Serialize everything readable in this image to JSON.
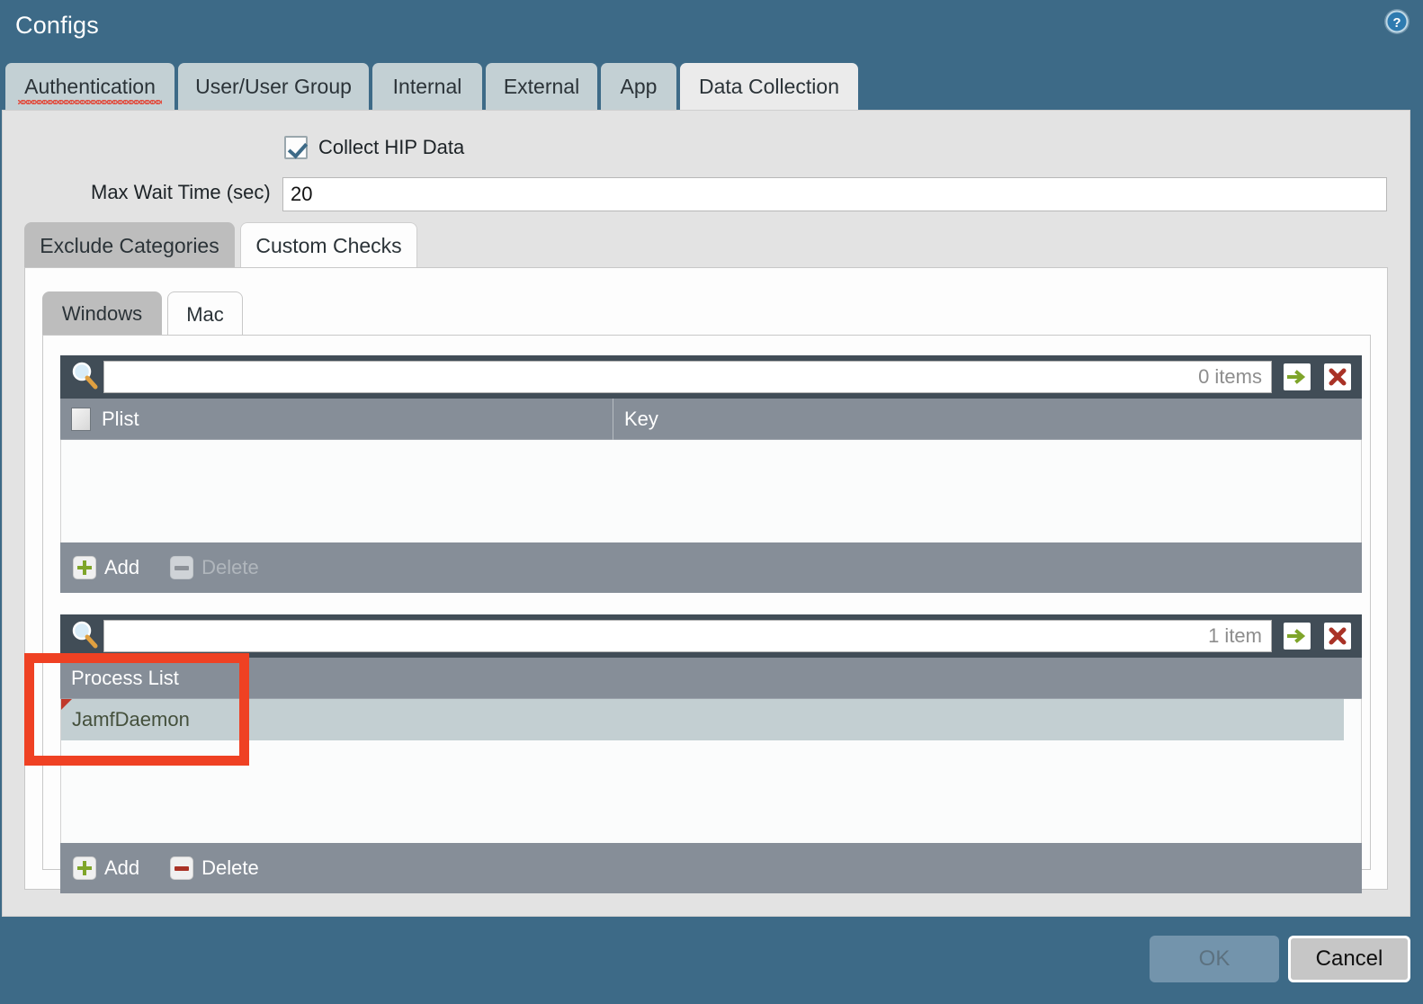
{
  "window": {
    "title": "Configs",
    "help_icon": "help-circle-icon"
  },
  "main_tabs": [
    {
      "label": "Authentication",
      "active": false,
      "misspelled": true
    },
    {
      "label": "User/User Group",
      "active": false
    },
    {
      "label": "Internal",
      "active": false
    },
    {
      "label": "External",
      "active": false
    },
    {
      "label": "App",
      "active": false
    },
    {
      "label": "Data Collection",
      "active": true
    }
  ],
  "form": {
    "collect_hip_label": "Collect HIP Data",
    "collect_hip_checked": true,
    "max_wait_label": "Max Wait Time (sec)",
    "max_wait_value": "20",
    "max_wait_placeholder": ""
  },
  "sub_tabs": [
    {
      "label": "Exclude Categories",
      "active": false
    },
    {
      "label": "Custom Checks",
      "active": true
    }
  ],
  "os_tabs": [
    {
      "label": "Windows",
      "active": false
    },
    {
      "label": "Mac",
      "active": true
    }
  ],
  "grids": [
    {
      "name": "plist-grid",
      "search_value": "",
      "search_placeholder": "",
      "item_count": "0 items",
      "columns": [
        "Plist",
        "Key"
      ],
      "rows": [],
      "add_label": "Add",
      "delete_label": "Delete",
      "delete_enabled": false
    },
    {
      "name": "process-list-grid",
      "search_value": "",
      "search_placeholder": "",
      "item_count": "1 item",
      "columns": [
        "Process List"
      ],
      "rows": [
        {
          "value": "JamfDaemon",
          "selected": true,
          "flagged": true
        }
      ],
      "add_label": "Add",
      "delete_label": "Delete",
      "delete_enabled": true
    }
  ],
  "footer": {
    "ok_label": "OK",
    "ok_enabled": false,
    "cancel_label": "Cancel"
  },
  "colors": {
    "titlebar": "#3d6a87",
    "panel_bg": "#e3e3e3",
    "grid_toolbar": "#414d57",
    "grid_header": "#868e98",
    "row_selected": "#c3cfd2",
    "row_text": "#44503c",
    "annotation": "#ef4123",
    "add_icon": "#7fa52a",
    "delete_icon": "#a93226"
  },
  "icons": {
    "search": "search-icon",
    "go": "arrow-right-icon",
    "clear": "close-x-icon",
    "add": "plus-icon",
    "delete": "minus-icon"
  }
}
